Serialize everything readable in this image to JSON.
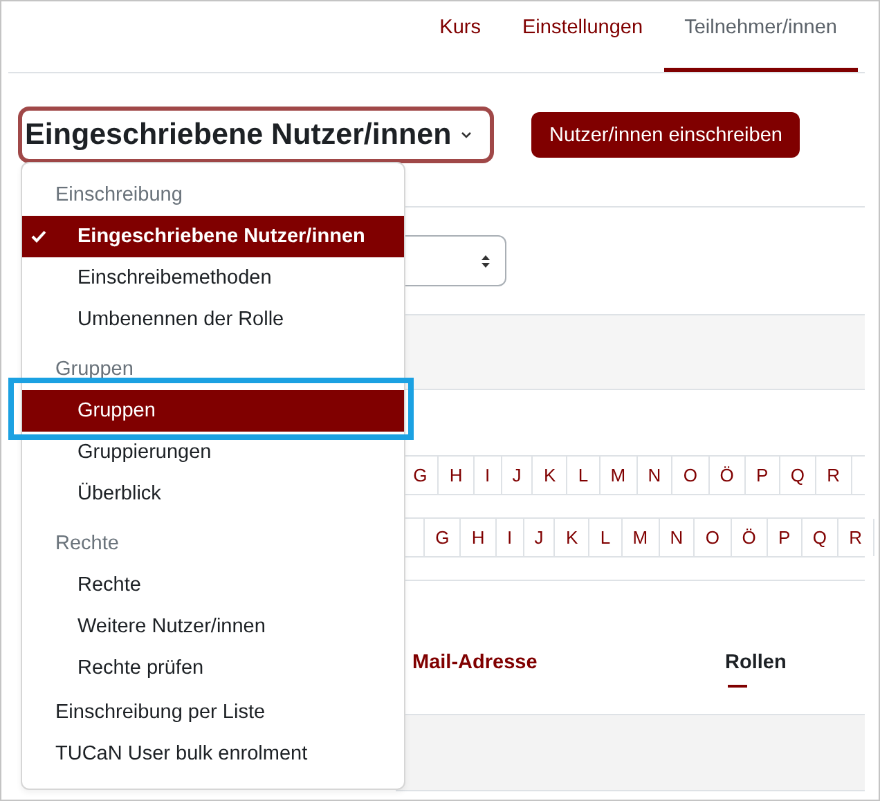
{
  "nav_tabs": [
    {
      "label": "Kurs",
      "selected": false
    },
    {
      "label": "Einstellungen",
      "selected": false
    },
    {
      "label": "Teilnehmer/innen",
      "selected": true
    }
  ],
  "page_select": {
    "value": "Eingeschriebene Nutzer/innen"
  },
  "enrol_button": {
    "label": "Nutzer/innen einschreiben"
  },
  "letter_rows": [
    [
      "G",
      "H",
      "I",
      "J",
      "K",
      "L",
      "M",
      "N",
      "O",
      "Ö",
      "P",
      "Q",
      "R"
    ],
    [
      "G",
      "H",
      "I",
      "J",
      "K",
      "L",
      "M",
      "N",
      "O",
      "Ö",
      "P",
      "Q",
      "R"
    ]
  ],
  "table": {
    "columns": [
      {
        "label": "Mail-Adresse",
        "kind": "link",
        "sort_mark": false
      },
      {
        "label": "Rollen",
        "kind": "text",
        "sort_mark": true
      }
    ]
  },
  "menu": {
    "groups": [
      {
        "header": "Einschreibung",
        "items": [
          {
            "label": "Eingeschriebene Nutzer/innen",
            "selected": true,
            "highlighted": true,
            "annotated": false
          },
          {
            "label": "Einschreibemethoden",
            "selected": false,
            "highlighted": false,
            "annotated": false
          },
          {
            "label": "Umbenennen der Rolle",
            "selected": false,
            "highlighted": false,
            "annotated": false
          }
        ]
      },
      {
        "header": "Gruppen",
        "items": [
          {
            "label": "Gruppen",
            "selected": false,
            "highlighted": true,
            "annotated": true
          },
          {
            "label": "Gruppierungen",
            "selected": false,
            "highlighted": false,
            "annotated": false
          },
          {
            "label": "Überblick",
            "selected": false,
            "highlighted": false,
            "annotated": false
          }
        ]
      },
      {
        "header": "Rechte",
        "items": [
          {
            "label": "Rechte",
            "selected": false,
            "highlighted": false,
            "annotated": false
          },
          {
            "label": "Weitere Nutzer/innen",
            "selected": false,
            "highlighted": false,
            "annotated": false
          },
          {
            "label": "Rechte prüfen",
            "selected": false,
            "highlighted": false,
            "annotated": false
          }
        ]
      }
    ],
    "items": [
      {
        "label": "Einschreibung per Liste",
        "selected": false,
        "highlighted": false,
        "annotated": false
      },
      {
        "label": "TUCaN User bulk enrolment",
        "selected": false,
        "highlighted": false,
        "annotated": false
      }
    ]
  }
}
